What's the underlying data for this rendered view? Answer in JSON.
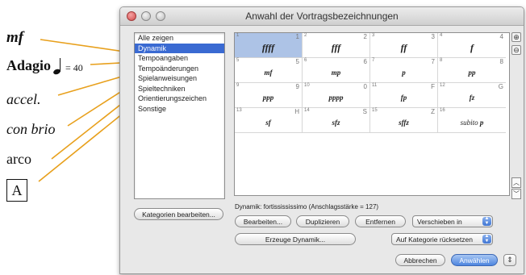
{
  "annotations": {
    "mf": "mf",
    "adagio": "Adagio",
    "tempo": "= 40",
    "accel": "accel.",
    "con_brio": "con brio",
    "arco": "arco",
    "rehearsal": "A"
  },
  "colors": {
    "leader_line": "#e8a01c",
    "selection": "#3a6ad2",
    "cell_selection": "#adc3e6"
  },
  "window": {
    "title": "Anwahl der Vortragsbezeichnungen",
    "categories": [
      {
        "label": "Alle zeigen"
      },
      {
        "label": "Dynamik",
        "selected": true
      },
      {
        "label": "Tempoangaben"
      },
      {
        "label": "Tempoänderungen"
      },
      {
        "label": "Spielanweisungen"
      },
      {
        "label": "Spieltechniken"
      },
      {
        "label": "Orientierungszeichen"
      },
      {
        "label": "Sonstige"
      }
    ],
    "cells": [
      {
        "num": "1",
        "key": "1",
        "sym": "ffff",
        "selected": true
      },
      {
        "num": "2",
        "key": "2",
        "sym": "fff"
      },
      {
        "num": "3",
        "key": "3",
        "sym": "ff"
      },
      {
        "num": "4",
        "key": "4",
        "sym": "f"
      },
      {
        "num": "5",
        "key": "5",
        "sym": "mf"
      },
      {
        "num": "6",
        "key": "6",
        "sym": "mp"
      },
      {
        "num": "7",
        "key": "7",
        "sym": "p"
      },
      {
        "num": "8",
        "key": "8",
        "sym": "pp"
      },
      {
        "num": "9",
        "key": "9",
        "sym": "ppp"
      },
      {
        "num": "10",
        "key": "0",
        "sym": "pppp"
      },
      {
        "num": "11",
        "key": "F",
        "sym": "fp"
      },
      {
        "num": "12",
        "key": "G",
        "sym": "fz"
      },
      {
        "num": "13",
        "key": "H",
        "sym": "sf"
      },
      {
        "num": "14",
        "key": "S",
        "sym": "sfz"
      },
      {
        "num": "15",
        "key": "Z",
        "sym": "sffz"
      },
      {
        "num": "16",
        "key": "",
        "sym_word": "subito",
        "sym": "p"
      }
    ],
    "status": "Dynamik: fortissississimo (Anschlagsstärke = 127)",
    "buttons": {
      "edit_categories": "Kategorien bearbeiten...",
      "edit": "Bearbeiten...",
      "duplicate": "Duplizieren",
      "remove": "Entfernen",
      "move_into": "Verschieben in",
      "create_dynamic": "Erzeuge Dynamik...",
      "reset_category": "Auf Kategorie rücksetzen",
      "cancel": "Abbrechen",
      "select": "Anwählen"
    },
    "icons": {
      "zoom_in": "zoom-in-icon",
      "zoom_out": "zoom-out-icon",
      "scroll_up": "scroll-up-icon",
      "scroll_down": "scroll-down-icon",
      "options": "gear-icon"
    }
  }
}
